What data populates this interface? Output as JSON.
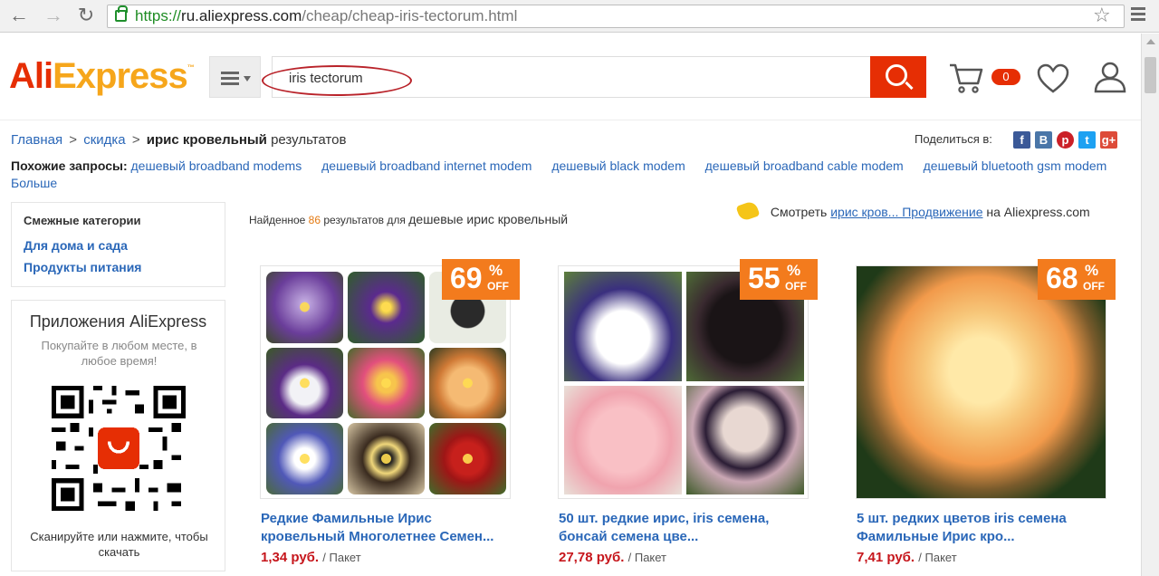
{
  "browser": {
    "url_scheme": "https://",
    "url_domain": "ru.aliexpress.com",
    "url_path": "/cheap/cheap-iris-tectorum.html"
  },
  "header": {
    "logo_ali": "Ali",
    "logo_express": "Express",
    "logo_tm": "™",
    "search_value": "iris tectorum",
    "cart_count": "0"
  },
  "breadcrumb": {
    "home": "Главная",
    "sep1": ">",
    "discount": "скидка",
    "sep2": ">",
    "current": "ирис кровельный",
    "tail": "результатов"
  },
  "share": {
    "label": "Поделиться в:",
    "icons": [
      "facebook-icon",
      "vk-icon",
      "pinterest-icon",
      "twitter-icon",
      "google-plus-icon"
    ]
  },
  "related": {
    "label": "Похожие запросы:",
    "links": [
      "дешевый broadband modems",
      "дешевый broadband internet modem",
      "дешевый black modem",
      "дешевый broadband cable modem",
      "дешевый bluetooth gsm modem",
      "Больше"
    ]
  },
  "sidebar": {
    "categories_title": "Смежные категории",
    "categories": [
      "Для дома и сада",
      "Продукты питания"
    ],
    "app_title": "Приложения AliExpress",
    "app_subtitle": "Покупайте в любом месте, в любое время!",
    "app_caption": "Сканируйте или нажмите, чтобы скачать"
  },
  "results": {
    "found_prefix": "Найденное",
    "found_count": "86",
    "found_mid": "результатов для",
    "found_query": "дешевые ирис кровельный",
    "promo_prefix": "Смотреть",
    "promo_link": "ирис кров... Продвижение",
    "promo_suffix": "на Aliexpress.com"
  },
  "products": [
    {
      "discount": "69",
      "percent": "%",
      "off": "OFF",
      "title": "Редкие Фамильные Ирис кровельный Многолетнее Семен...",
      "price": "1,34 руб.",
      "unit": "/ Пакет"
    },
    {
      "discount": "55",
      "percent": "%",
      "off": "OFF",
      "title": "50 шт. редкие ирис, iris семена, бонсай семена цве...",
      "price": "27,78 руб.",
      "unit": "/ Пакет"
    },
    {
      "discount": "68",
      "percent": "%",
      "off": "OFF",
      "title": "5 шт. редких цветов iris семена Фамильные Ирис кро...",
      "price": "7,41 руб.",
      "unit": "/ Пакет"
    }
  ],
  "colors": {
    "brand_red": "#e62e04",
    "brand_orange": "#f6a61b",
    "link_blue": "#2a67b8",
    "price_red": "#c6161c",
    "badge_orange": "#f37b1d"
  }
}
